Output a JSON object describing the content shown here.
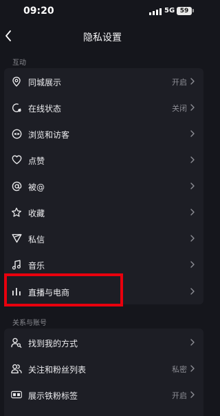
{
  "status_bar": {
    "time": "09:20",
    "network": "5G",
    "battery": "59"
  },
  "nav": {
    "title": "隐私设置"
  },
  "sections": [
    {
      "header": "互动",
      "rows": [
        {
          "label": "同城展示",
          "value": "开启",
          "icon": "location-pin-icon"
        },
        {
          "label": "在线状态",
          "value": "关闭",
          "icon": "online-status-icon"
        },
        {
          "label": "浏览和访客",
          "value": "",
          "icon": "eye-icon"
        },
        {
          "label": "点赞",
          "value": "",
          "icon": "heart-icon"
        },
        {
          "label": "被@",
          "value": "",
          "icon": "at-sign-icon"
        },
        {
          "label": "收藏",
          "value": "",
          "icon": "star-icon"
        },
        {
          "label": "私信",
          "value": "",
          "icon": "send-icon"
        },
        {
          "label": "音乐",
          "value": "",
          "icon": "music-note-icon"
        },
        {
          "label": "直播与电商",
          "value": "",
          "icon": "live-bars-icon"
        }
      ]
    },
    {
      "header": "关系与账号",
      "rows": [
        {
          "label": "找到我的方式",
          "value": "",
          "icon": "find-user-icon"
        },
        {
          "label": "关注和粉丝列表",
          "value": "私密",
          "icon": "followers-icon"
        },
        {
          "label": "展示铁粉标签",
          "value": "开启",
          "icon": "fan-badge-icon"
        }
      ]
    }
  ],
  "colors": {
    "background": "#15161c",
    "group": "#1d1e25",
    "highlight": "#e8000d"
  }
}
